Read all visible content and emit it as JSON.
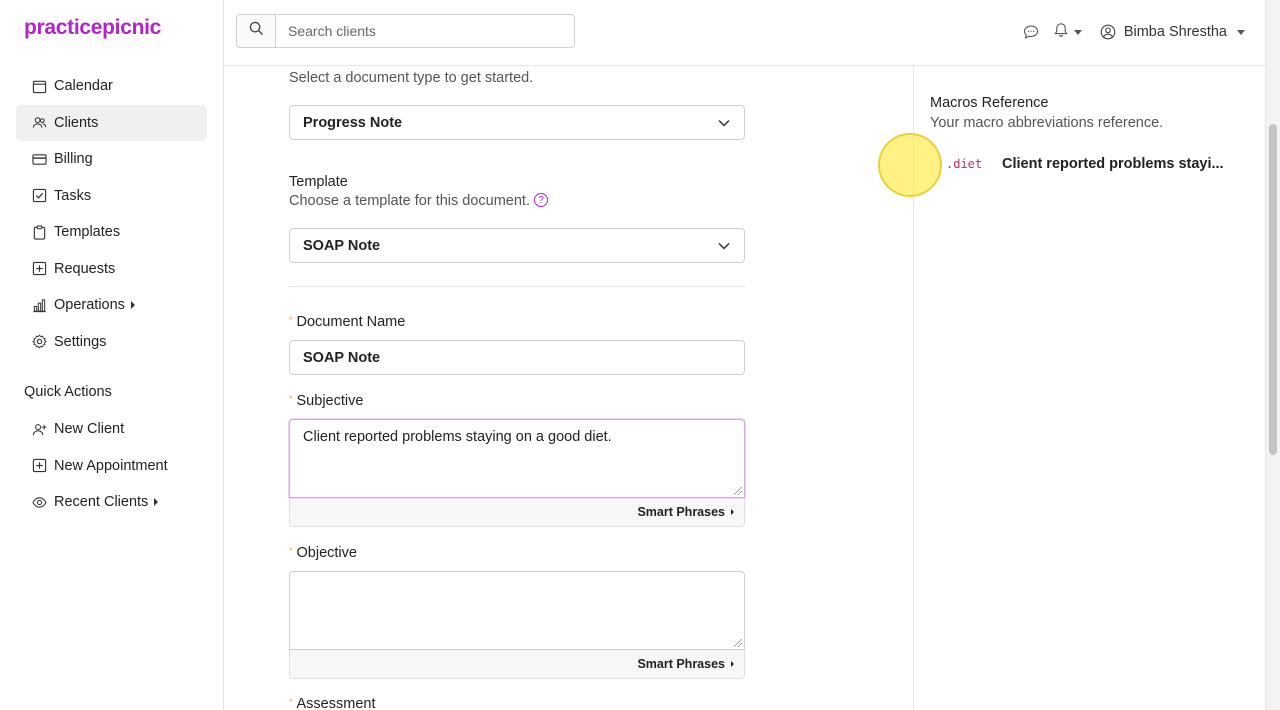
{
  "app": {
    "logo": "practicepicnic",
    "brand_color": "#b224c9"
  },
  "sidebar": {
    "items": [
      {
        "label": "Calendar",
        "icon": "calendar-icon",
        "active": false
      },
      {
        "label": "Clients",
        "icon": "users-icon",
        "active": true
      },
      {
        "label": "Billing",
        "icon": "credit-card-icon",
        "active": false
      },
      {
        "label": "Tasks",
        "icon": "checkbox-icon",
        "active": false
      },
      {
        "label": "Templates",
        "icon": "clipboard-icon",
        "active": false
      },
      {
        "label": "Requests",
        "icon": "plus-square-icon",
        "active": false
      },
      {
        "label": "Operations",
        "icon": "bar-chart-icon",
        "active": false,
        "has_submenu": true
      },
      {
        "label": "Settings",
        "icon": "gear-icon",
        "active": false
      }
    ],
    "quick_actions_title": "Quick Actions",
    "quick_actions": [
      {
        "label": "New Client",
        "icon": "add-user-icon"
      },
      {
        "label": "New Appointment",
        "icon": "plus-square-icon"
      },
      {
        "label": "Recent Clients",
        "icon": "eye-icon",
        "has_submenu": true
      }
    ]
  },
  "topbar": {
    "search_placeholder": "Search clients",
    "user_name": "Bimba Shrestha",
    "icons": [
      "chat-icon",
      "bell-icon",
      "user-circle-icon"
    ]
  },
  "form": {
    "document_type_help": "Select a document type to get started.",
    "document_type_value": "Progress Note",
    "template_label": "Template",
    "template_help": "Choose a template for this document.",
    "template_value": "SOAP Note",
    "document_name_label": "Document Name",
    "document_name_value": "SOAP Note",
    "subjective_label": "Subjective",
    "subjective_value": "Client reported problems staying on a good diet.",
    "objective_label": "Objective",
    "objective_value": "",
    "assessment_label": "Assessment",
    "smart_phrases_label": "Smart Phrases",
    "required_marker": "*",
    "help_marker": "?"
  },
  "macros": {
    "title": "Macros Reference",
    "subtitle": "Your macro abbreviations reference.",
    "items": [
      {
        "code": ".diet",
        "text": "Client reported problems stayi..."
      }
    ]
  }
}
